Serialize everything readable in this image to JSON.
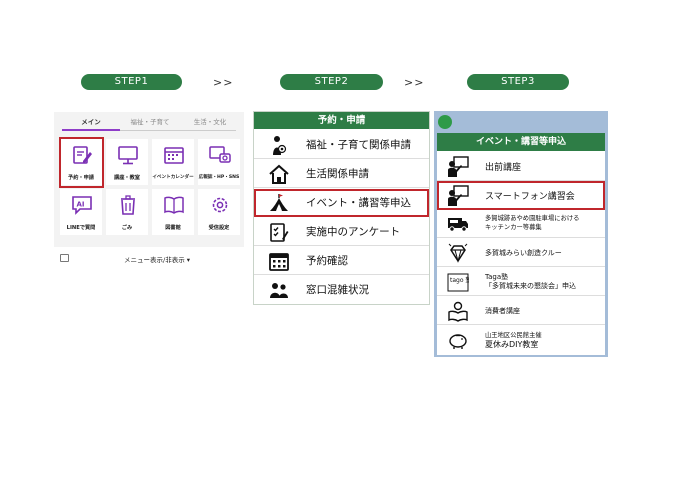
{
  "steps": {
    "step1": "STEP1",
    "step2": "STEP2",
    "step3": "STEP3",
    "arrow1": ">>",
    "arrow2": ">>"
  },
  "panel1": {
    "tabs": [
      "メイン",
      "福祉・子育て",
      "生活・文化"
    ],
    "tiles": [
      {
        "label": "予約・申請",
        "icon": "edit-form-icon"
      },
      {
        "label": "講座・教室",
        "icon": "monitor-icon"
      },
      {
        "label": "イベントカレンダー",
        "icon": "calendar-icon"
      },
      {
        "label": "広報誌・HP・SNS",
        "icon": "screen-camera-icon"
      },
      {
        "label": "LINEで質問",
        "icon": "ai-chat-icon"
      },
      {
        "label": "ごみ",
        "icon": "trash-icon"
      },
      {
        "label": "図書館",
        "icon": "book-icon"
      },
      {
        "label": "受信設定",
        "icon": "gear-icon"
      }
    ],
    "menu_toggle": "メニュー表示/非表示 ▾"
  },
  "panel2": {
    "title": "予約・申請",
    "items": [
      {
        "label": "福祉・子育て関係申請",
        "icon": "parent-child-icon"
      },
      {
        "label": "生活関係申請",
        "icon": "house-icon"
      },
      {
        "label": "イベント・講習等申込",
        "icon": "tent-icon"
      },
      {
        "label": "実施中のアンケート",
        "icon": "survey-icon"
      },
      {
        "label": "予約確認",
        "icon": "calendar-icon"
      },
      {
        "label": "窓口混雑状況",
        "icon": "crowd-icon"
      }
    ]
  },
  "panel3": {
    "title": "イベント・講習等申込",
    "items": [
      {
        "label": "出前講座",
        "icon": "teacher-icon"
      },
      {
        "label": "スマートフォン講習会",
        "icon": "teacher-icon"
      },
      {
        "line1": "多賀城跡あやめ園駐車場における",
        "line2": "キッチンカー等募集",
        "icon": "food-truck-icon"
      },
      {
        "label": "多賀城みらい創造クルー",
        "icon": "diamond-icon"
      },
      {
        "line1": "Taga塾",
        "line2": "「多賀城未来の懇談会」申込",
        "icon": "taga-logo-icon",
        "icon_text": "tago 塾"
      },
      {
        "label": "消費者講座",
        "icon": "reader-icon"
      },
      {
        "line1": "山王地区公民館主催",
        "line2": "夏休みDIY教室",
        "icon": "piggy-bank-icon"
      }
    ]
  },
  "colors": {
    "brand_green": "#2e7d46",
    "highlight_red": "#c0262c",
    "tab_accent": "#8e3cc8",
    "panel3_bg": "#a4bcd8"
  }
}
